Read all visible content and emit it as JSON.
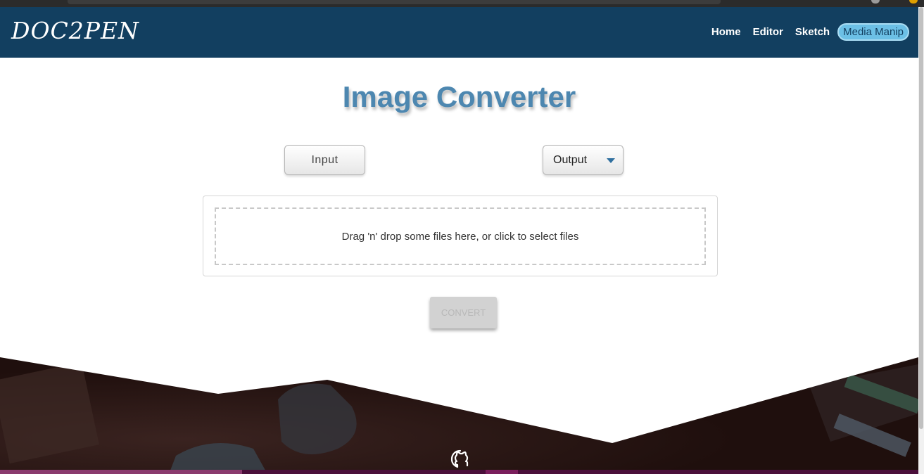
{
  "header": {
    "logo": "DOC2PEN",
    "nav": [
      {
        "label": "Home",
        "active": false
      },
      {
        "label": "Editor",
        "active": false
      },
      {
        "label": "Sketch",
        "active": false
      },
      {
        "label": "Media Manip",
        "active": true
      }
    ]
  },
  "main": {
    "title": "Image Converter",
    "input_label": "Input",
    "output_label": "Output",
    "dropzone_text": "Drag 'n' drop some files here, or click to select files",
    "convert_label": "CONVERT"
  },
  "footer": {
    "icon": "github-icon"
  },
  "colors": {
    "header_bg": "#123f60",
    "title": "#4d87b0",
    "active_nav": "#6cc0e6",
    "footer_dark": "#2a1411"
  }
}
